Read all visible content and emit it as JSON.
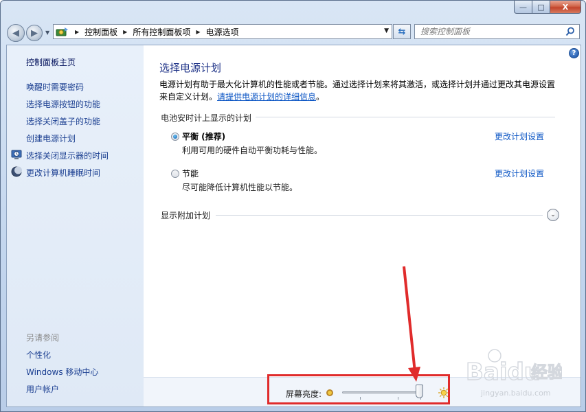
{
  "window": {
    "controls": {
      "minimize": "—",
      "maximize": "□",
      "close": "X"
    }
  },
  "navigation": {
    "back_icon": "back-arrow-icon",
    "forward_icon": "forward-arrow-icon",
    "breadcrumbs": [
      "控制面板",
      "所有控制面板项",
      "电源选项"
    ],
    "search_placeholder": "搜索控制面板"
  },
  "sidebar": {
    "home": "控制面板主页",
    "items": [
      {
        "label": "唤醒时需要密码",
        "icon": null
      },
      {
        "label": "选择电源按钮的功能",
        "icon": null
      },
      {
        "label": "选择关闭盖子的功能",
        "icon": null
      },
      {
        "label": "创建电源计划",
        "icon": null
      },
      {
        "label": "选择关闭显示器的时间",
        "icon": "display-clock-icon"
      },
      {
        "label": "更改计算机睡眠时间",
        "icon": "moon-icon"
      }
    ],
    "see_also_heading": "另请参阅",
    "see_also": [
      "个性化",
      "Windows 移动中心",
      "用户帐户"
    ]
  },
  "main": {
    "title": "选择电源计划",
    "description": "电源计划有助于最大化计算机的性能或者节能。通过选择计划来将其激活，或选择计划并通过更改其电源设置来自定义计划。",
    "description_link": "请提供电源计划的详细信息",
    "description_end": "。",
    "group_label": "电池安时计上显示的计划",
    "plans": [
      {
        "name": "平衡 (推荐)",
        "description": "利用可用的硬件自动平衡功耗与性能。",
        "link": "更改计划设置",
        "selected": true
      },
      {
        "name": "节能",
        "description": "尽可能降低计算机性能以节能。",
        "link": "更改计划设置",
        "selected": false
      }
    ],
    "extra_plans_label": "显示附加计划"
  },
  "brightness": {
    "label": "屏幕亮度:",
    "level": 1.0
  },
  "watermark": {
    "brand": "Baidu经验",
    "url": "jingyan.baidu.com"
  },
  "colors": {
    "link": "#0b55c4",
    "title": "#1e3287",
    "annotation": "#e02b2b"
  }
}
